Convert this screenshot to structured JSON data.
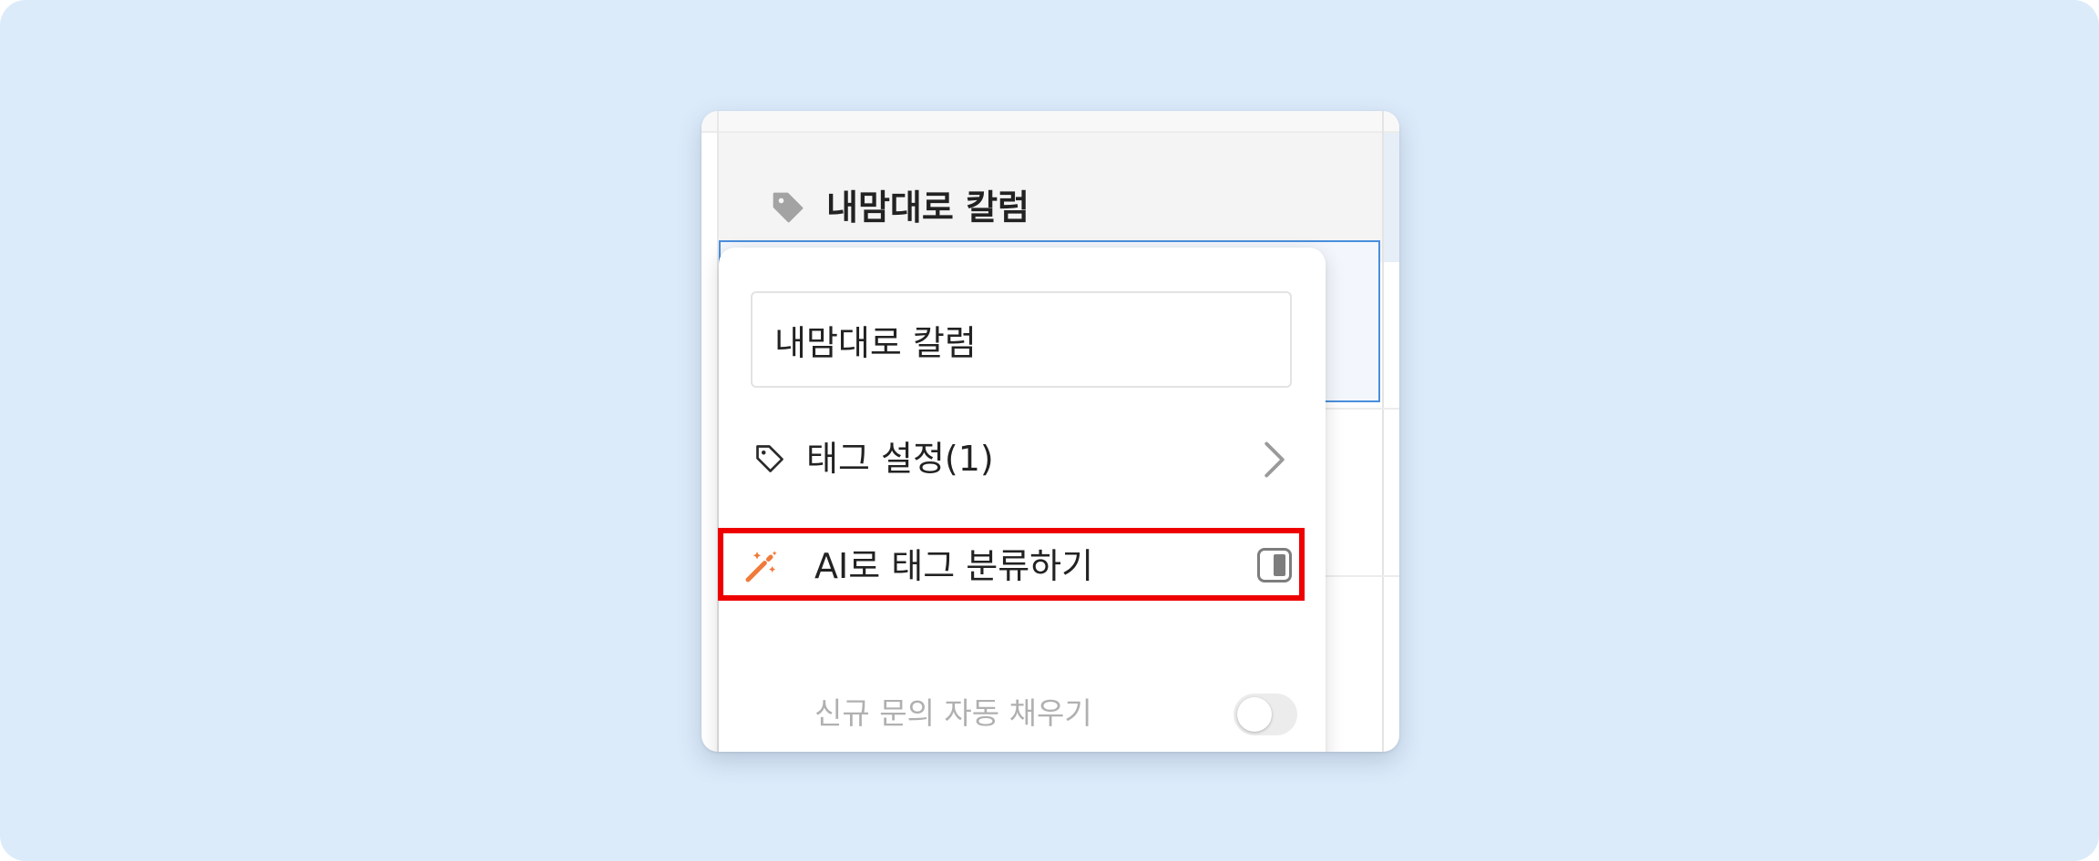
{
  "column": {
    "title": "내맘대로 칼럼",
    "icon": "tag-filled-icon"
  },
  "popover": {
    "name_value": "내맘대로 칼럼",
    "tag_settings": {
      "label": "태그 설정(1)",
      "icon": "tag-outline-icon",
      "trailing_icon": "chevron-right-icon"
    },
    "ai_classify": {
      "label": "AI로 태그 분류하기",
      "icon": "magic-wand-icon",
      "icon_color": "#f07a3a",
      "enabled": true
    },
    "auto_fill": {
      "label": "신규 문의 자동 채우기",
      "enabled": false
    }
  },
  "colors": {
    "background": "#dcebfa",
    "highlight": "#ee0000",
    "selection": "#4a8fdc"
  }
}
